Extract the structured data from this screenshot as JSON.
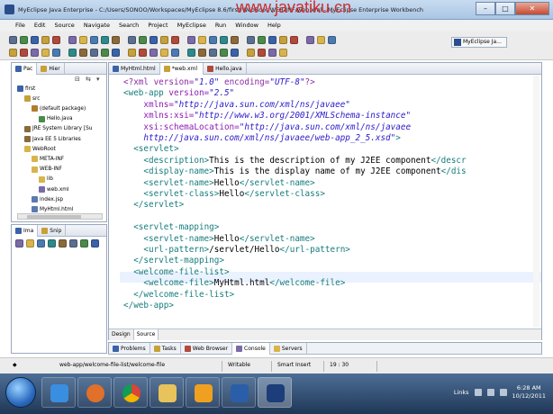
{
  "window": {
    "title": "MyEclipse Java Enterprise - C:/Users/SONOO/Workspaces/MyEclipse 8.6/first/WebRoot/WEB-INF/web.xml - MyEclipse Enterprise Workbench",
    "watermark": "www.javatiku.cn",
    "minimize": "–",
    "maximize": "□",
    "close": "✕"
  },
  "menu": [
    "File",
    "Edit",
    "Source",
    "Navigate",
    "Search",
    "Project",
    "MyEclipse",
    "Run",
    "Window",
    "Help"
  ],
  "perspective": "MyEclipse Ja...",
  "package_explorer": {
    "tabs": [
      {
        "label": "Pac"
      },
      {
        "label": "Hier"
      }
    ],
    "tree": [
      {
        "label": "first",
        "depth": 0,
        "icon": "project-icon",
        "color": "#3a62a8"
      },
      {
        "label": "src",
        "depth": 1,
        "icon": "source-folder-icon",
        "color": "#c7a03a"
      },
      {
        "label": "(default package)",
        "depth": 2,
        "icon": "package-icon",
        "color": "#b07d2e"
      },
      {
        "label": "Hello.java",
        "depth": 3,
        "icon": "java-file-icon",
        "color": "#4a8a4a"
      },
      {
        "label": "JRE System Library [Su",
        "depth": 1,
        "icon": "library-icon",
        "color": "#8a6a3a"
      },
      {
        "label": "Java EE 5 Libraries",
        "depth": 1,
        "icon": "library-icon",
        "color": "#8a6a3a"
      },
      {
        "label": "WebRoot",
        "depth": 1,
        "icon": "folder-icon",
        "color": "#d9b44a"
      },
      {
        "label": "META-INF",
        "depth": 2,
        "icon": "folder-icon",
        "color": "#d9b44a"
      },
      {
        "label": "WEB-INF",
        "depth": 2,
        "icon": "folder-icon",
        "color": "#d9b44a"
      },
      {
        "label": "lib",
        "depth": 3,
        "icon": "folder-icon",
        "color": "#d9b44a"
      },
      {
        "label": "web.xml",
        "depth": 3,
        "icon": "xml-file-icon",
        "color": "#7a6aa8"
      },
      {
        "label": "index.jsp",
        "depth": 2,
        "icon": "jsp-file-icon",
        "color": "#5a7ab0"
      },
      {
        "label": "MyHtml.html",
        "depth": 2,
        "icon": "html-file-icon",
        "color": "#5a7ab0"
      }
    ]
  },
  "image_panel": {
    "tabs": [
      {
        "label": "Ima"
      },
      {
        "label": "Snip"
      }
    ]
  },
  "editor": {
    "tabs": [
      {
        "label": "MyHtml.html",
        "active": false
      },
      {
        "label": "*web.xml",
        "active": true
      },
      {
        "label": "Hello.java",
        "active": false
      }
    ],
    "bottom_tabs": [
      {
        "label": "Design",
        "active": false
      },
      {
        "label": "Source",
        "active": true
      }
    ],
    "lines": [
      [
        {
          "t": "pi",
          "s": "<?xml version="
        },
        {
          "t": "val",
          "s": "\"1.0\""
        },
        {
          "t": "pi",
          "s": " encoding="
        },
        {
          "t": "val",
          "s": "\"UTF-8\""
        },
        {
          "t": "pi",
          "s": "?>"
        }
      ],
      [
        {
          "t": "tag",
          "s": "<web-app "
        },
        {
          "t": "attr",
          "s": "version="
        },
        {
          "t": "val",
          "s": "\"2.5\""
        }
      ],
      [
        {
          "t": "text",
          "s": "    "
        },
        {
          "t": "attr",
          "s": "xmlns="
        },
        {
          "t": "val",
          "s": "\"http://java.sun.com/xml/ns/javaee\""
        }
      ],
      [
        {
          "t": "text",
          "s": "    "
        },
        {
          "t": "attr",
          "s": "xmlns:xsi="
        },
        {
          "t": "val",
          "s": "\"http://www.w3.org/2001/XMLSchema-instance\""
        }
      ],
      [
        {
          "t": "text",
          "s": "    "
        },
        {
          "t": "attr",
          "s": "xsi:schemaLocation="
        },
        {
          "t": "val",
          "s": "\"http://java.sun.com/xml/ns/javaee"
        }
      ],
      [
        {
          "t": "text",
          "s": "    "
        },
        {
          "t": "val",
          "s": "http://java.sun.com/xml/ns/javaee/web-app_2_5.xsd\""
        },
        {
          "t": "tag",
          "s": ">"
        }
      ],
      [
        {
          "t": "text",
          "s": "  "
        },
        {
          "t": "tag",
          "s": "<servlet>"
        }
      ],
      [
        {
          "t": "text",
          "s": "    "
        },
        {
          "t": "tag",
          "s": "<description>"
        },
        {
          "t": "text",
          "s": "This is the description of my J2EE component"
        },
        {
          "t": "tag",
          "s": "</descr"
        }
      ],
      [
        {
          "t": "text",
          "s": "    "
        },
        {
          "t": "tag",
          "s": "<display-name>"
        },
        {
          "t": "text",
          "s": "This is the display name of my J2EE component"
        },
        {
          "t": "tag",
          "s": "</dis"
        }
      ],
      [
        {
          "t": "text",
          "s": "    "
        },
        {
          "t": "tag",
          "s": "<servlet-name>"
        },
        {
          "t": "text",
          "s": "Hello"
        },
        {
          "t": "tag",
          "s": "</servlet-name>"
        }
      ],
      [
        {
          "t": "text",
          "s": "    "
        },
        {
          "t": "tag",
          "s": "<servlet-class>"
        },
        {
          "t": "text",
          "s": "Hello"
        },
        {
          "t": "tag",
          "s": "</servlet-class>"
        }
      ],
      [
        {
          "t": "text",
          "s": "  "
        },
        {
          "t": "tag",
          "s": "</servlet>"
        }
      ],
      [
        {
          "t": "text",
          "s": ""
        }
      ],
      [
        {
          "t": "text",
          "s": "  "
        },
        {
          "t": "tag",
          "s": "<servlet-mapping>"
        }
      ],
      [
        {
          "t": "text",
          "s": "    "
        },
        {
          "t": "tag",
          "s": "<servlet-name>"
        },
        {
          "t": "text",
          "s": "Hello"
        },
        {
          "t": "tag",
          "s": "</servlet-name>"
        }
      ],
      [
        {
          "t": "text",
          "s": "    "
        },
        {
          "t": "tag",
          "s": "<url-pattern>"
        },
        {
          "t": "text",
          "s": "/servlet/Hello"
        },
        {
          "t": "tag",
          "s": "</url-pattern>"
        }
      ],
      [
        {
          "t": "text",
          "s": "  "
        },
        {
          "t": "tag",
          "s": "</servlet-mapping>"
        }
      ],
      [
        {
          "t": "text",
          "s": "  "
        },
        {
          "t": "tag",
          "s": "<welcome-file-list>"
        }
      ],
      [
        {
          "t": "text",
          "s": "    "
        },
        {
          "t": "tag",
          "s": "<welcome-file>"
        },
        {
          "t": "text",
          "s": "MyHtml.html"
        },
        {
          "t": "tag",
          "s": "</welcome-file>"
        }
      ],
      [
        {
          "t": "text",
          "s": "  "
        },
        {
          "t": "tag",
          "s": "</welcome-file-list>"
        }
      ],
      [
        {
          "t": "tag",
          "s": "</web-app>"
        }
      ]
    ]
  },
  "bottom_panel": {
    "tabs": [
      {
        "label": "Problems"
      },
      {
        "label": "Tasks"
      },
      {
        "label": "Web Browser"
      },
      {
        "label": "Console"
      },
      {
        "label": "Servers"
      }
    ]
  },
  "status": {
    "path": "web-app/welcome-file-list/welcome-file",
    "mode": "Writable",
    "insert": "Smart Insert",
    "position": "19 : 30"
  },
  "taskbar": {
    "links": "Links",
    "time": "6:28 AM",
    "date": "10/12/2011"
  },
  "colors": {
    "tag": "#167c7c",
    "attr": "#8e1cb0",
    "value": "#2a19c9",
    "watermark": "#d22c2c"
  }
}
